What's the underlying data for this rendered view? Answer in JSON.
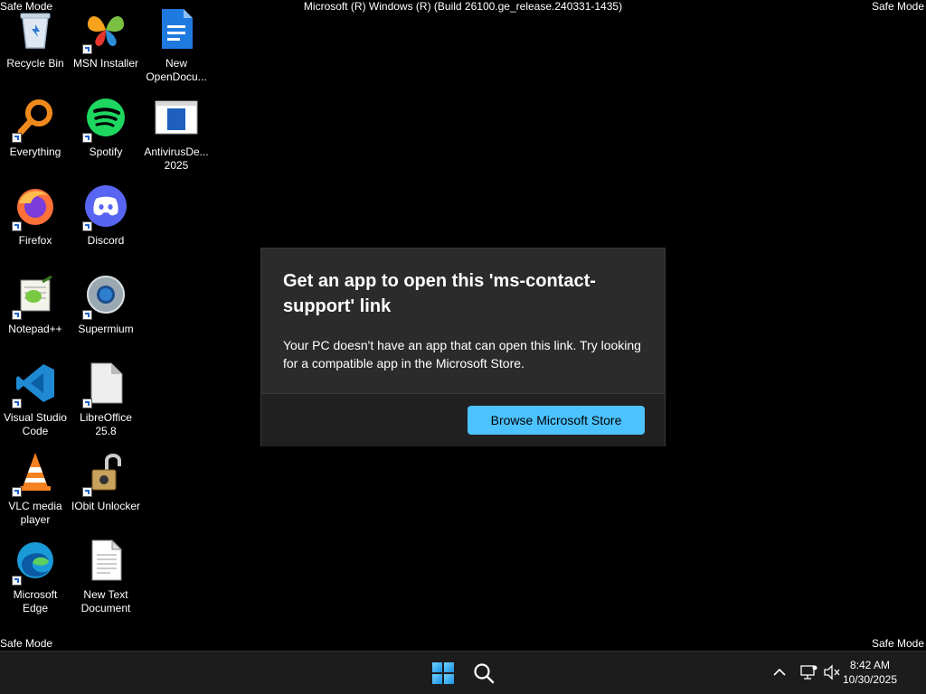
{
  "watermarks": {
    "top_left": "Safe Mode",
    "top_right": "Safe Mode",
    "bottom_left": "Safe Mode",
    "bottom_right": "Safe Mode",
    "build": "Microsoft (R) Windows (R) (Build 26100.ge_release.240331-1435)"
  },
  "desktop_icons": [
    {
      "label": "Recycle Bin",
      "icon": "recycle-bin-icon"
    },
    {
      "label": "MSN Installer",
      "icon": "msn-butterfly-icon"
    },
    {
      "label": "New OpenDocu...",
      "icon": "document-icon"
    },
    {
      "label": "Everything",
      "icon": "magnifier-icon"
    },
    {
      "label": "Spotify",
      "icon": "spotify-icon"
    },
    {
      "label": "AntivirusDe... 2025",
      "icon": "installer-window-icon"
    },
    {
      "label": "Firefox",
      "icon": "firefox-icon"
    },
    {
      "label": "Discord",
      "icon": "discord-icon"
    },
    {
      "label": "Notepad++",
      "icon": "notepadpp-icon"
    },
    {
      "label": "Supermium",
      "icon": "supermium-icon"
    },
    {
      "label": "Visual Studio Code",
      "icon": "vscode-icon"
    },
    {
      "label": "LibreOffice 25.8",
      "icon": "libreoffice-icon"
    },
    {
      "label": "VLC media player",
      "icon": "vlc-cone-icon"
    },
    {
      "label": "IObit Unlocker",
      "icon": "padlock-icon"
    },
    {
      "label": "Microsoft Edge",
      "icon": "edge-icon"
    },
    {
      "label": "New Text Document",
      "icon": "text-file-icon"
    }
  ],
  "dialog": {
    "title": "Get an app to open this 'ms-contact-support' link",
    "body": "Your PC doesn't have an app that can open this link. Try looking for a compatible app in the Microsoft Store.",
    "button_label": "Browse Microsoft Store",
    "button_color": "#4cc2ff"
  },
  "taskbar": {
    "start_icon": "windows-logo-icon",
    "search_icon": "search-icon",
    "tray": [
      "chevron-up-icon",
      "network-icon",
      "volume-muted-icon"
    ],
    "time": "8:42 AM",
    "date": "10/30/2025"
  }
}
